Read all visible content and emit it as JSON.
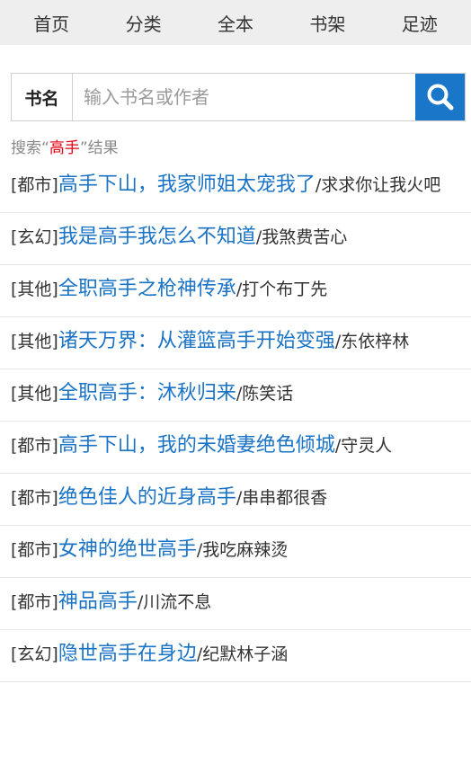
{
  "nav": [
    "首页",
    "分类",
    "全本",
    "书架",
    "足迹"
  ],
  "search": {
    "label": "书名",
    "placeholder": "输入书名或作者"
  },
  "result": {
    "prefix": "搜索“",
    "keyword": "高手",
    "suffix": "”结果"
  },
  "items": [
    {
      "category": "[都市]",
      "title": "高手下山，我家师姐太宠我了",
      "author": "/求求你让我火吧",
      "wrap": true
    },
    {
      "category": "[玄幻]",
      "title": "我是高手我怎么不知道",
      "author": "/我煞费苦心",
      "wrap": false
    },
    {
      "category": "[其他]",
      "title": "全职高手之枪神传承",
      "author": "/打个布丁先",
      "wrap": false
    },
    {
      "category": "[其他]",
      "title": "诸天万界：从灌篮高手开始变强",
      "author": "/东依梓林",
      "wrap": true
    },
    {
      "category": "[其他]",
      "title": "全职高手：沐秋归来",
      "author": "/陈笑话",
      "wrap": false
    },
    {
      "category": "[都市]",
      "title": "高手下山，我的未婚妻绝色倾城",
      "author": "/守灵人",
      "wrap": true
    },
    {
      "category": "[都市]",
      "title": "绝色佳人的近身高手",
      "author": "/串串都很香",
      "wrap": false
    },
    {
      "category": "[都市]",
      "title": "女神的绝世高手",
      "author": "/我吃麻辣烫",
      "wrap": false
    },
    {
      "category": "[都市]",
      "title": "神品高手",
      "author": "/川流不息",
      "wrap": false
    },
    {
      "category": "[玄幻]",
      "title": "隐世高手在身边",
      "author": "/纪默林子涵",
      "wrap": false
    }
  ]
}
